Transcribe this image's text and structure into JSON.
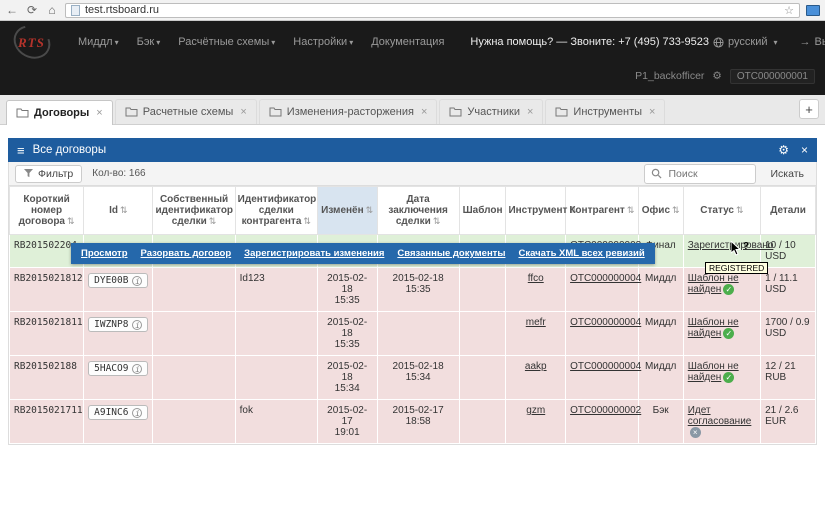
{
  "icons": {
    "back": "←",
    "reload": "⟳",
    "home": "⌂",
    "star": "☆",
    "menu": "≡",
    "gear": "⚙",
    "close": "×",
    "caret": "▾",
    "sort": "⇅",
    "info": "i",
    "check": "✓",
    "cross": "×",
    "logout_arrow": "→",
    "plus": "+"
  },
  "browser": {
    "url": "test.rtsboard.ru"
  },
  "navbar": {
    "brand": "RTS",
    "menu": [
      {
        "label": "Миддл"
      },
      {
        "label": "Бэк"
      },
      {
        "label": "Расчётные схемы"
      },
      {
        "label": "Настройки"
      },
      {
        "label": "Документация"
      }
    ],
    "help_text": "Нужна помощь? — Звоните: +7 (495) 733-9523",
    "language": "русский",
    "logout_label": "Выйти",
    "user_name": "P1_backofficer",
    "account_id": "OTC000000001"
  },
  "tabs": {
    "items": [
      {
        "label": "Договоры"
      },
      {
        "label": "Расчетные схемы"
      },
      {
        "label": "Изменения-расторжения"
      },
      {
        "label": "Участники"
      },
      {
        "label": "Инструменты"
      }
    ]
  },
  "panel": {
    "title": "Все договоры",
    "filter_label": "Фильтр",
    "count_label": "Кол-во: 166",
    "search_placeholder": "Поиск",
    "search_button_label": "Искать"
  },
  "context_menu": {
    "items": [
      "Просмотр",
      "Разорвать договор",
      "Зарегистрировать изменения",
      "Связанные документы",
      "Скачать XML всех ревизий"
    ]
  },
  "tooltip": {
    "text": "REGISTERED"
  },
  "table": {
    "columns": [
      "Короткий номер договора",
      "Id",
      "Собственный идентификатор сделки",
      "Идентификатор сделки контрагента",
      "Изменён",
      "Дата заключения сделки",
      "Шаблон",
      "Инструмент",
      "Контрагент",
      "Офис",
      "Статус",
      "Детали"
    ],
    "rows": [
      {
        "short_number": "RB201502204",
        "id": "",
        "own_deal_id": "",
        "cp_deal_id": "",
        "changed": "",
        "deal_date": "",
        "template": "",
        "instrument": "",
        "counterparty": "OTC000000003",
        "office": "Финал",
        "status": "Зарегистрировано",
        "details": "10 / 10\nUSD"
      },
      {
        "short_number": "RB2015021812",
        "id": "DYE00B",
        "own_deal_id": "",
        "cp_deal_id": "Id123",
        "changed": "2015-02-18\n15:35",
        "deal_date": "2015-02-18 15:35",
        "template": "",
        "instrument": "ffco",
        "counterparty": "OTC000000004",
        "office": "Миддл",
        "status": "Шаблон не найден",
        "details": "1 / 11.1\nUSD"
      },
      {
        "short_number": "RB2015021811",
        "id": "IWZNP8",
        "own_deal_id": "",
        "cp_deal_id": "",
        "changed": "2015-02-18\n15:35",
        "deal_date": "",
        "template": "",
        "instrument": "mefr",
        "counterparty": "OTC000000004",
        "office": "Миддл",
        "status": "Шаблон не найден",
        "details": "1700 / 0.9\nUSD"
      },
      {
        "short_number": "RB201502188",
        "id": "5HACO9",
        "own_deal_id": "",
        "cp_deal_id": "",
        "changed": "2015-02-18\n15:34",
        "deal_date": "2015-02-18 15:34",
        "template": "",
        "instrument": "aakp",
        "counterparty": "OTC000000004",
        "office": "Миддл",
        "status": "Шаблон не найден",
        "details": "12 / 21\nRUB"
      },
      {
        "short_number": "RB2015021711",
        "id": "A9INC6",
        "own_deal_id": "",
        "cp_deal_id": "fok",
        "changed": "2015-02-17\n19:01",
        "deal_date": "2015-02-17 18:58",
        "template": "",
        "instrument": "gzm",
        "counterparty": "OTC000000002",
        "office": "Бэк",
        "status": "Идет согласование",
        "details": "21 / 2.6\nEUR"
      }
    ]
  }
}
